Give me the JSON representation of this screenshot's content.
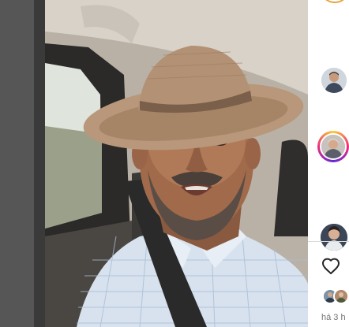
{
  "post": {
    "timestamp": "há 3 h"
  },
  "icons": {
    "like": "heart-outline-icon"
  },
  "colors": {
    "backdrop": "#565656",
    "story_ring": "#e8a13a",
    "divider": "#dbdbdb",
    "muted_text": "#737373"
  }
}
